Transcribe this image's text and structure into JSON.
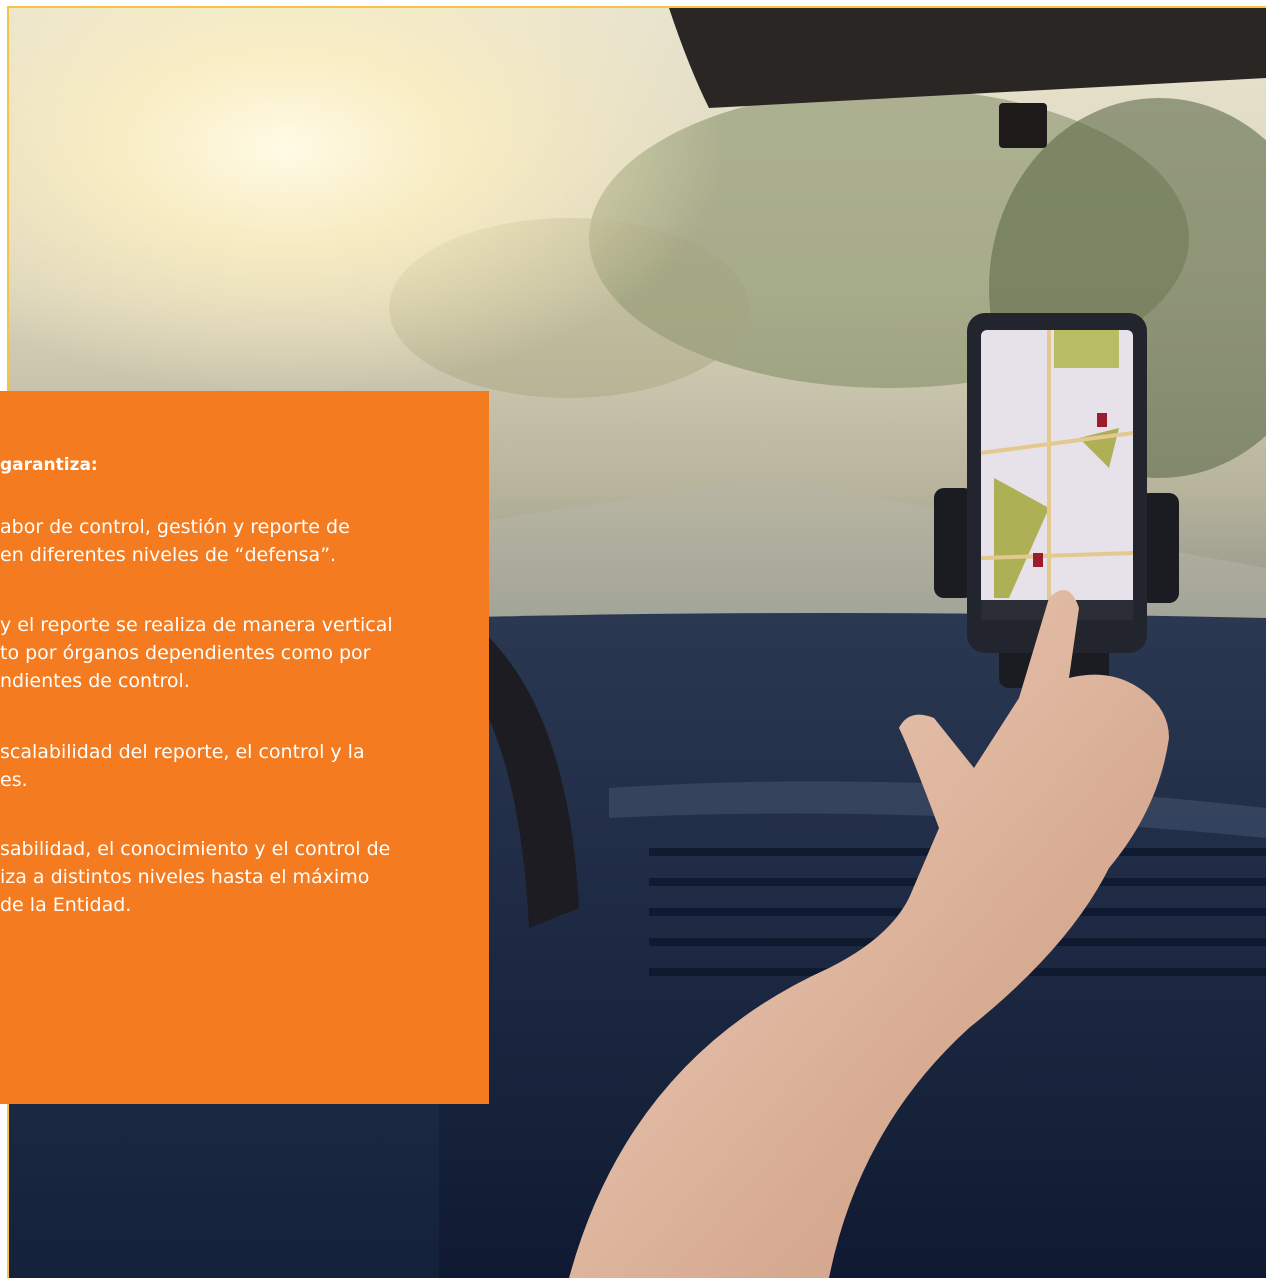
{
  "info_box": {
    "heading": "garantiza:",
    "paragraphs": [
      {
        "lines": [
          "abor de control, gestión y reporte de",
          "en diferentes niveles de “defensa”."
        ]
      },
      {
        "lines": [
          "y el reporte se realiza de manera vertical",
          "to por órganos dependientes como por",
          "ndientes de control."
        ]
      },
      {
        "lines": [
          "scalabilidad del reporte, el control y la",
          "es."
        ]
      },
      {
        "lines": [
          "sabilidad, el conocimiento y el control de",
          "iza a distintos niveles hasta el máximo",
          "de la Entidad."
        ]
      }
    ],
    "background_color": "#f47b20",
    "text_color": "#ffffff"
  },
  "frame": {
    "border_color": "#f6c445"
  },
  "photo": {
    "description_icon": "car-navigation-photo",
    "phone_icon": "smartphone-map-icon"
  }
}
